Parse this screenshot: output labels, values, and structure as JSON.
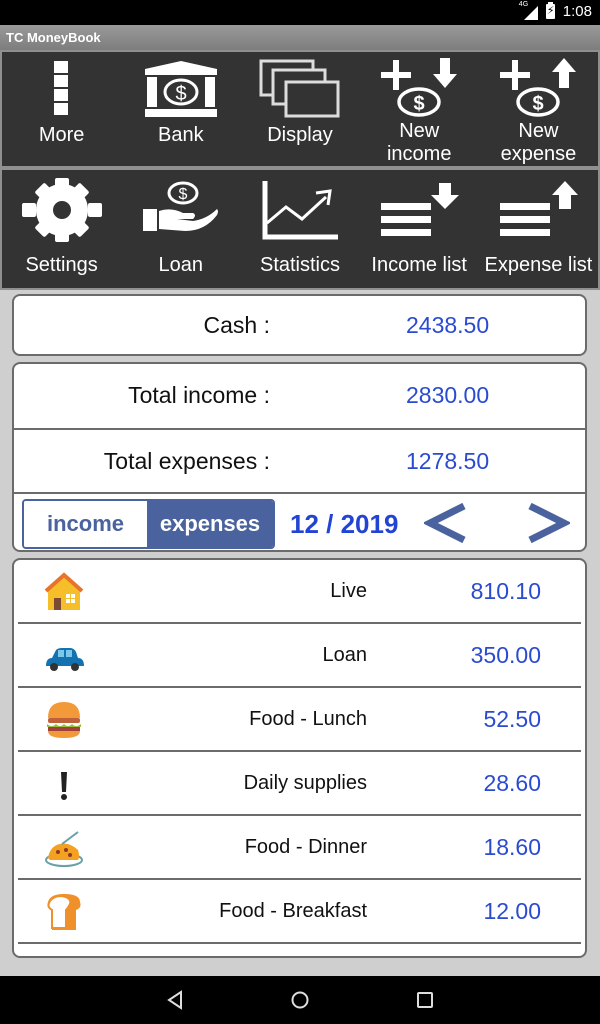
{
  "status_bar": {
    "network": "4G",
    "time": "1:08"
  },
  "app_title": "TC MoneyBook",
  "toolbar_row1": [
    {
      "id": "more",
      "label": "More",
      "icon": "more-vertical-icon"
    },
    {
      "id": "bank",
      "label": "Bank",
      "icon": "bank-icon"
    },
    {
      "id": "display",
      "label": "Display",
      "icon": "display-windows-icon"
    },
    {
      "id": "new-income",
      "label": "New income",
      "label_line1": "New",
      "label_line2": "income",
      "icon": "add-income-icon"
    },
    {
      "id": "new-expense",
      "label": "New expense",
      "label_line1": "New",
      "label_line2": "expense",
      "icon": "add-expense-icon"
    }
  ],
  "toolbar_row2": [
    {
      "id": "settings",
      "label": "Settings",
      "icon": "gear-icon"
    },
    {
      "id": "loan",
      "label": "Loan",
      "icon": "loan-hand-icon"
    },
    {
      "id": "statistics",
      "label": "Statistics",
      "icon": "chart-icon"
    },
    {
      "id": "income-list",
      "label": "Income list",
      "icon": "income-list-icon"
    },
    {
      "id": "expense-list",
      "label": "Expense list",
      "icon": "expense-list-icon"
    }
  ],
  "summary": {
    "cash_label": "Cash :",
    "cash_value": "2438.50",
    "total_income_label": "Total income :",
    "total_income_value": "2830.00",
    "total_expenses_label": "Total expenses :",
    "total_expenses_value": "1278.50"
  },
  "controls": {
    "toggle_income": "income",
    "toggle_expenses": "expenses",
    "selected": "expenses",
    "period": "12 / 2019",
    "prev_label": "<",
    "next_label": ">"
  },
  "colors": {
    "accent": "#4a629e",
    "value_blue": "#2a4bd0",
    "toolbar_bg": "#333333"
  },
  "expense_items": [
    {
      "category": "Live",
      "amount": "810.10",
      "icon": "house-icon"
    },
    {
      "category": "Loan",
      "amount": "350.00",
      "icon": "car-icon"
    },
    {
      "category": "Food - Lunch",
      "amount": "52.50",
      "icon": "hamburger-icon"
    },
    {
      "category": "Daily supplies",
      "amount": "28.60",
      "icon": "exclamation-icon"
    },
    {
      "category": "Food - Dinner",
      "amount": "18.60",
      "icon": "spaghetti-icon"
    },
    {
      "category": "Food - Breakfast",
      "amount": "12.00",
      "icon": "bread-icon"
    }
  ]
}
